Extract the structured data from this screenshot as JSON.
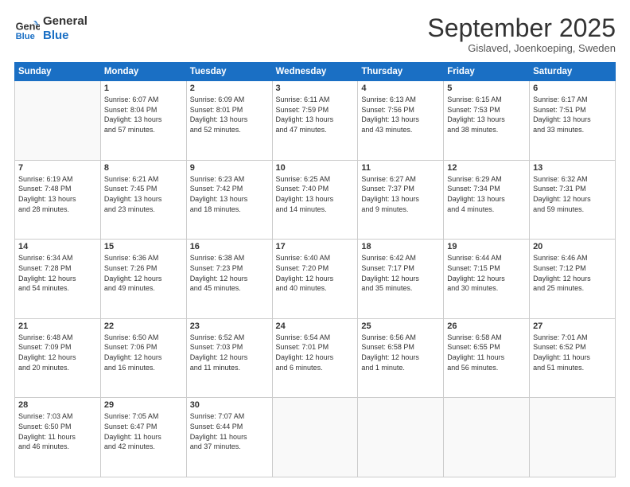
{
  "header": {
    "logo_line1": "General",
    "logo_line2": "Blue",
    "month": "September 2025",
    "location": "Gislaved, Joenkoeping, Sweden"
  },
  "weekdays": [
    "Sunday",
    "Monday",
    "Tuesday",
    "Wednesday",
    "Thursday",
    "Friday",
    "Saturday"
  ],
  "weeks": [
    [
      {
        "day": "",
        "info": ""
      },
      {
        "day": "1",
        "info": "Sunrise: 6:07 AM\nSunset: 8:04 PM\nDaylight: 13 hours\nand 57 minutes."
      },
      {
        "day": "2",
        "info": "Sunrise: 6:09 AM\nSunset: 8:01 PM\nDaylight: 13 hours\nand 52 minutes."
      },
      {
        "day": "3",
        "info": "Sunrise: 6:11 AM\nSunset: 7:59 PM\nDaylight: 13 hours\nand 47 minutes."
      },
      {
        "day": "4",
        "info": "Sunrise: 6:13 AM\nSunset: 7:56 PM\nDaylight: 13 hours\nand 43 minutes."
      },
      {
        "day": "5",
        "info": "Sunrise: 6:15 AM\nSunset: 7:53 PM\nDaylight: 13 hours\nand 38 minutes."
      },
      {
        "day": "6",
        "info": "Sunrise: 6:17 AM\nSunset: 7:51 PM\nDaylight: 13 hours\nand 33 minutes."
      }
    ],
    [
      {
        "day": "7",
        "info": "Sunrise: 6:19 AM\nSunset: 7:48 PM\nDaylight: 13 hours\nand 28 minutes."
      },
      {
        "day": "8",
        "info": "Sunrise: 6:21 AM\nSunset: 7:45 PM\nDaylight: 13 hours\nand 23 minutes."
      },
      {
        "day": "9",
        "info": "Sunrise: 6:23 AM\nSunset: 7:42 PM\nDaylight: 13 hours\nand 18 minutes."
      },
      {
        "day": "10",
        "info": "Sunrise: 6:25 AM\nSunset: 7:40 PM\nDaylight: 13 hours\nand 14 minutes."
      },
      {
        "day": "11",
        "info": "Sunrise: 6:27 AM\nSunset: 7:37 PM\nDaylight: 13 hours\nand 9 minutes."
      },
      {
        "day": "12",
        "info": "Sunrise: 6:29 AM\nSunset: 7:34 PM\nDaylight: 13 hours\nand 4 minutes."
      },
      {
        "day": "13",
        "info": "Sunrise: 6:32 AM\nSunset: 7:31 PM\nDaylight: 12 hours\nand 59 minutes."
      }
    ],
    [
      {
        "day": "14",
        "info": "Sunrise: 6:34 AM\nSunset: 7:28 PM\nDaylight: 12 hours\nand 54 minutes."
      },
      {
        "day": "15",
        "info": "Sunrise: 6:36 AM\nSunset: 7:26 PM\nDaylight: 12 hours\nand 49 minutes."
      },
      {
        "day": "16",
        "info": "Sunrise: 6:38 AM\nSunset: 7:23 PM\nDaylight: 12 hours\nand 45 minutes."
      },
      {
        "day": "17",
        "info": "Sunrise: 6:40 AM\nSunset: 7:20 PM\nDaylight: 12 hours\nand 40 minutes."
      },
      {
        "day": "18",
        "info": "Sunrise: 6:42 AM\nSunset: 7:17 PM\nDaylight: 12 hours\nand 35 minutes."
      },
      {
        "day": "19",
        "info": "Sunrise: 6:44 AM\nSunset: 7:15 PM\nDaylight: 12 hours\nand 30 minutes."
      },
      {
        "day": "20",
        "info": "Sunrise: 6:46 AM\nSunset: 7:12 PM\nDaylight: 12 hours\nand 25 minutes."
      }
    ],
    [
      {
        "day": "21",
        "info": "Sunrise: 6:48 AM\nSunset: 7:09 PM\nDaylight: 12 hours\nand 20 minutes."
      },
      {
        "day": "22",
        "info": "Sunrise: 6:50 AM\nSunset: 7:06 PM\nDaylight: 12 hours\nand 16 minutes."
      },
      {
        "day": "23",
        "info": "Sunrise: 6:52 AM\nSunset: 7:03 PM\nDaylight: 12 hours\nand 11 minutes."
      },
      {
        "day": "24",
        "info": "Sunrise: 6:54 AM\nSunset: 7:01 PM\nDaylight: 12 hours\nand 6 minutes."
      },
      {
        "day": "25",
        "info": "Sunrise: 6:56 AM\nSunset: 6:58 PM\nDaylight: 12 hours\nand 1 minute."
      },
      {
        "day": "26",
        "info": "Sunrise: 6:58 AM\nSunset: 6:55 PM\nDaylight: 11 hours\nand 56 minutes."
      },
      {
        "day": "27",
        "info": "Sunrise: 7:01 AM\nSunset: 6:52 PM\nDaylight: 11 hours\nand 51 minutes."
      }
    ],
    [
      {
        "day": "28",
        "info": "Sunrise: 7:03 AM\nSunset: 6:50 PM\nDaylight: 11 hours\nand 46 minutes."
      },
      {
        "day": "29",
        "info": "Sunrise: 7:05 AM\nSunset: 6:47 PM\nDaylight: 11 hours\nand 42 minutes."
      },
      {
        "day": "30",
        "info": "Sunrise: 7:07 AM\nSunset: 6:44 PM\nDaylight: 11 hours\nand 37 minutes."
      },
      {
        "day": "",
        "info": ""
      },
      {
        "day": "",
        "info": ""
      },
      {
        "day": "",
        "info": ""
      },
      {
        "day": "",
        "info": ""
      }
    ]
  ]
}
